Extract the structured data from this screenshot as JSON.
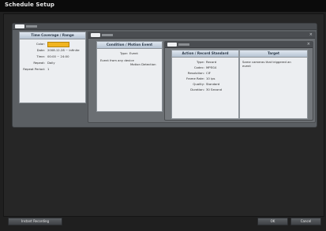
{
  "window": {
    "title": "Schedule Setup"
  },
  "cards": {
    "time": {
      "header": "Time Coverage / Range",
      "rows": [
        {
          "label": "Color:",
          "value": ""
        },
        {
          "label": "Date:",
          "value": "2008.12.28 ~ Infinite"
        },
        {
          "label": "Time:",
          "value": "00:00 ~ 24:00"
        },
        {
          "label": "Repeat:",
          "value": "Daily"
        },
        {
          "label": "Repeat Period:",
          "value": "1"
        }
      ],
      "color": "#f1b41f"
    },
    "condition": {
      "header": "Condition / Motion Event",
      "type_label": "Type:",
      "type_value": "Event",
      "line1": "Event from any device",
      "line2": "Motion Detection"
    },
    "action": {
      "header": "Action / Record Standard",
      "rows": [
        {
          "label": "Type:",
          "value": "Record"
        },
        {
          "label": "Codec:",
          "value": "MPEG4"
        },
        {
          "label": "Resolution:",
          "value": "CIF"
        },
        {
          "label": "Frame Rate:",
          "value": "10 ips"
        },
        {
          "label": "Quality:",
          "value": "Standard"
        },
        {
          "label": "Duration:",
          "value": "30 Second"
        }
      ]
    },
    "target": {
      "header": "Target",
      "text1": "Same cameras that triggered an",
      "text2": "event"
    }
  },
  "footer": {
    "instant_label": "Instant Recording",
    "ok_label": "OK",
    "cancel_label": "Cancel"
  }
}
